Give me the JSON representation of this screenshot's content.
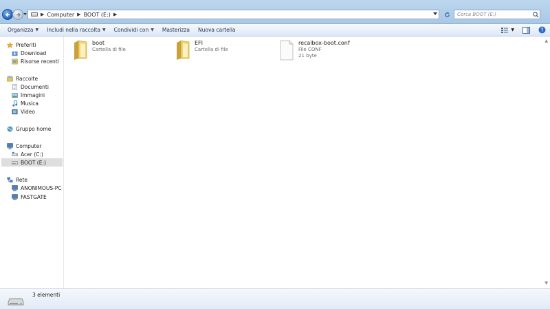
{
  "address": {
    "crumbs": [
      "Computer",
      "BOOT (E:)"
    ]
  },
  "search": {
    "placeholder": "Cerca BOOT (E:)"
  },
  "toolbar": {
    "organize": "Organizza",
    "include": "Includi nella raccolta",
    "share": "Condividi con",
    "burn": "Masterizza",
    "new_folder": "Nuova cartella"
  },
  "sidebar": {
    "favorites": "Preferiti",
    "download": "Download",
    "recent": "Risorse recenti",
    "libraries": "Raccolte",
    "documents": "Documenti",
    "pictures": "Immagini",
    "music": "Musica",
    "video": "Video",
    "homegroup": "Gruppo home",
    "computer": "Computer",
    "drive_c": "Acer (C:)",
    "drive_e": "BOOT (E:)",
    "network": "Rete",
    "pc1": "ANONIMOUS-PC",
    "pc2": "FASTGATE"
  },
  "files": [
    {
      "name": "boot",
      "type": "Cartella di file",
      "size": "",
      "icon": "folder-icon"
    },
    {
      "name": "EFI",
      "type": "Cartella di file",
      "size": "",
      "icon": "folder-icon"
    },
    {
      "name": "recalbox-boot.conf",
      "type": "File CONF",
      "size": "21 byte",
      "icon": "document-icon"
    }
  ],
  "status": {
    "count": "3 elementi"
  },
  "colors": {
    "accent": "#2362b8",
    "selected": "#dedede",
    "folder": "#e8c45a"
  }
}
